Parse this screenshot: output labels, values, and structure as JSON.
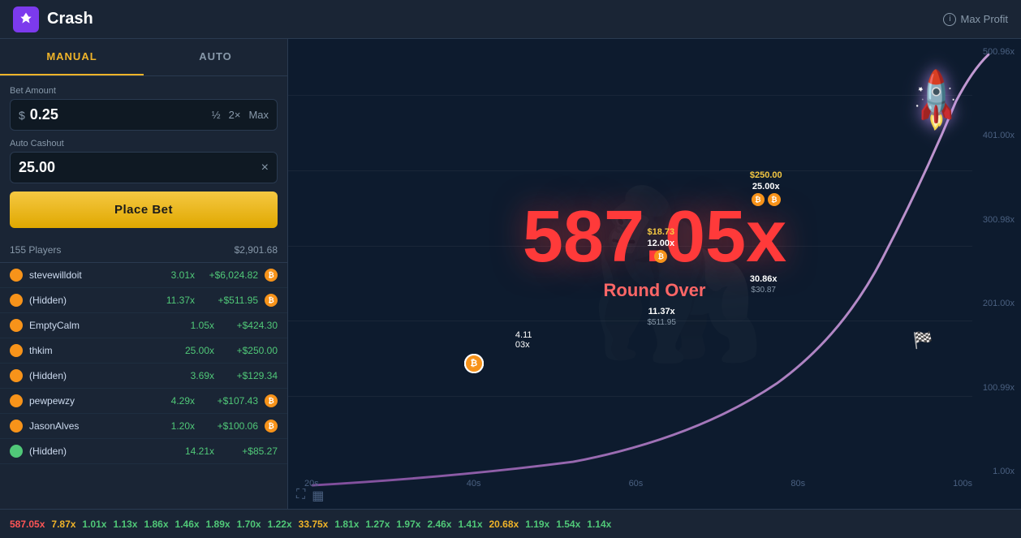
{
  "header": {
    "title": "Crash",
    "icon_symbol": "🚀",
    "max_profit_label": "Max Profit"
  },
  "tabs": [
    {
      "id": "manual",
      "label": "MANUAL",
      "active": true
    },
    {
      "id": "auto",
      "label": "AUTO",
      "active": false
    }
  ],
  "bet_form": {
    "bet_amount_label": "Bet Amount",
    "bet_value": "0.25",
    "currency_symbol": "$",
    "half_label": "½",
    "double_label": "2×",
    "max_label": "Max",
    "auto_cashout_label": "Auto Cashout",
    "cashout_value": "25.00",
    "place_bet_label": "Place Bet"
  },
  "players_info": {
    "count": "155 Players",
    "total": "$2,901.68"
  },
  "players": [
    {
      "name": "stevewilldoit",
      "color": "#f7931a",
      "mult": "3.01x",
      "win": "+$6,024.82",
      "has_btc": true
    },
    {
      "name": "(Hidden)",
      "color": "#f7931a",
      "mult": "11.37x",
      "win": "+$511.95",
      "has_btc": true
    },
    {
      "name": "EmptyCalm",
      "color": "#f7931a",
      "mult": "1.05x",
      "win": "+$424.30",
      "has_btc": false
    },
    {
      "name": "thkim",
      "color": "#f7931a",
      "mult": "25.00x",
      "win": "+$250.00",
      "has_btc": false
    },
    {
      "name": "(Hidden)",
      "color": "#f7931a",
      "mult": "3.69x",
      "win": "+$129.34",
      "has_btc": false
    },
    {
      "name": "pewpewzy",
      "color": "#f7931a",
      "mult": "4.29x",
      "win": "+$107.43",
      "has_btc": true
    },
    {
      "name": "JasonAlves",
      "color": "#f7931a",
      "mult": "1.20x",
      "win": "+$100.06",
      "has_btc": true
    },
    {
      "name": "(Hidden)",
      "color": "#50c878",
      "mult": "14.21x",
      "win": "+$85.27",
      "has_btc": false
    }
  ],
  "game": {
    "multiplier": "587.05x",
    "status": "Round Over",
    "y_labels": [
      "500.96x",
      "401.00x",
      "300.98x",
      "201.00x",
      "100.99x",
      "1.00x"
    ],
    "x_labels": [
      "20s",
      "40s",
      "60s",
      "80s",
      "100s"
    ],
    "bet_markers": [
      {
        "dollar": "$18.73",
        "mult": "12.00x",
        "sub": "",
        "x_pct": 52,
        "y_pct": 48
      },
      {
        "dollar": "$250.00",
        "mult": "25.00x",
        "sub": "",
        "x_pct": 66,
        "y_pct": 38
      },
      {
        "dollar": "",
        "mult": "11.37x",
        "sub": "$511.95",
        "x_pct": 52,
        "y_pct": 62
      },
      {
        "dollar": "",
        "mult": "30.86x",
        "sub": "$30.87",
        "x_pct": 66,
        "y_pct": 58
      }
    ]
  },
  "history": {
    "items": [
      {
        "value": "587.05x",
        "type": "high"
      },
      {
        "value": "7.87x",
        "type": "med"
      },
      {
        "value": "1.01x",
        "type": "low"
      },
      {
        "value": "1.13x",
        "type": "low"
      },
      {
        "value": "1.86x",
        "type": "low"
      },
      {
        "value": "1.46x",
        "type": "low"
      },
      {
        "value": "1.89x",
        "type": "low"
      },
      {
        "value": "1.70x",
        "type": "low"
      },
      {
        "value": "1.22x",
        "type": "low"
      },
      {
        "value": "33.75x",
        "type": "med"
      },
      {
        "value": "1.81x",
        "type": "low"
      },
      {
        "value": "1.27x",
        "type": "low"
      },
      {
        "value": "1.97x",
        "type": "low"
      },
      {
        "value": "2.46x",
        "type": "low"
      },
      {
        "value": "1.41x",
        "type": "low"
      },
      {
        "value": "20.68x",
        "type": "med"
      },
      {
        "value": "1.19x",
        "type": "low"
      },
      {
        "value": "1.54x",
        "type": "low"
      },
      {
        "value": "1.14x",
        "type": "low"
      }
    ]
  }
}
